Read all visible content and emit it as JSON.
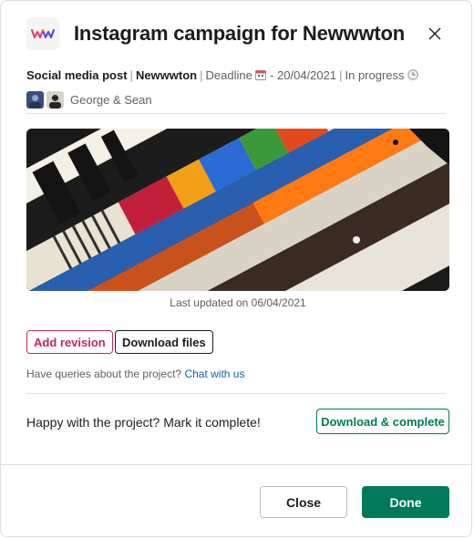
{
  "header": {
    "title": "Instagram campaign for Newwwton",
    "logo_icon": "brand-logo-icon",
    "close_icon": "close-icon"
  },
  "meta": {
    "type": "Social media post",
    "client": "Newwwton",
    "deadline_label": "Deadline",
    "deadline_icon": "calendar-icon",
    "deadline_date": "- 20/04/2021",
    "status": "In progress",
    "status_icon": "clock-icon"
  },
  "people": {
    "names": "George & Sean"
  },
  "preview": {
    "caption": "Last updated on 06/04/2021"
  },
  "actions": {
    "add_revision": "Add revision",
    "download_files": "Download files"
  },
  "queries": {
    "text": "Have queries about the project?",
    "link": "Chat with us"
  },
  "complete": {
    "text": "Happy with the project? Mark it complete!",
    "button": "Download & complete"
  },
  "footer": {
    "close": "Close",
    "done": "Done"
  },
  "colors": {
    "accent_green": "#007a5a",
    "revision_pink": "#c9245e",
    "link_blue": "#1264a3"
  }
}
